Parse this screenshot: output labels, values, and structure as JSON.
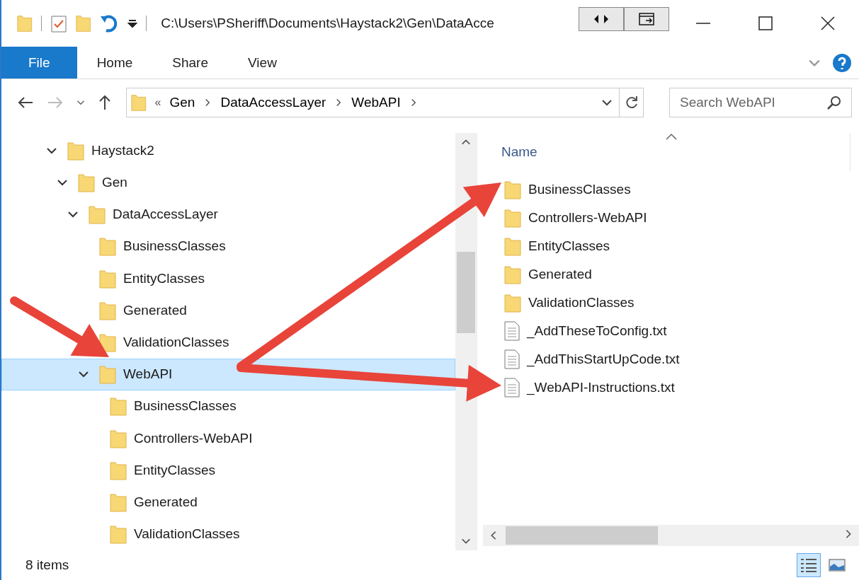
{
  "window": {
    "title": "C:\\Users\\PSheriff\\Documents\\Haystack2\\Gen\\DataAcce"
  },
  "ribbon": {
    "tabs": [
      {
        "label": "File",
        "selected": true
      },
      {
        "label": "Home",
        "selected": false
      },
      {
        "label": "Share",
        "selected": false
      },
      {
        "label": "View",
        "selected": false
      }
    ]
  },
  "address_bar": {
    "overflow": "«",
    "crumbs": [
      "Gen",
      "DataAccessLayer",
      "WebAPI"
    ]
  },
  "search": {
    "placeholder": "Search WebAPI"
  },
  "tree": [
    {
      "label": "Haystack2",
      "expanded": true,
      "selected": false,
      "children": [
        {
          "label": "Gen",
          "expanded": true,
          "selected": false,
          "children": [
            {
              "label": "DataAccessLayer",
              "expanded": true,
              "selected": false,
              "children": [
                {
                  "label": "BusinessClasses",
                  "expanded": false,
                  "selected": false
                },
                {
                  "label": "EntityClasses",
                  "expanded": false,
                  "selected": false
                },
                {
                  "label": "Generated",
                  "expanded": false,
                  "selected": false
                },
                {
                  "label": "ValidationClasses",
                  "expanded": false,
                  "selected": false
                },
                {
                  "label": "WebAPI",
                  "expanded": true,
                  "selected": true,
                  "children": [
                    {
                      "label": "BusinessClasses",
                      "expanded": false,
                      "selected": false
                    },
                    {
                      "label": "Controllers-WebAPI",
                      "expanded": false,
                      "selected": false
                    },
                    {
                      "label": "EntityClasses",
                      "expanded": false,
                      "selected": false
                    },
                    {
                      "label": "Generated",
                      "expanded": false,
                      "selected": false
                    },
                    {
                      "label": "ValidationClasses",
                      "expanded": false,
                      "selected": false
                    }
                  ]
                }
              ]
            }
          ]
        }
      ]
    }
  ],
  "file_list": {
    "columns": [
      "Name"
    ],
    "items": [
      {
        "name": "BusinessClasses",
        "kind": "folder"
      },
      {
        "name": "Controllers-WebAPI",
        "kind": "folder"
      },
      {
        "name": "EntityClasses",
        "kind": "folder"
      },
      {
        "name": "Generated",
        "kind": "folder"
      },
      {
        "name": "ValidationClasses",
        "kind": "folder"
      },
      {
        "name": "_AddTheseToConfig.txt",
        "kind": "file"
      },
      {
        "name": "_AddThisStartUpCode.txt",
        "kind": "file"
      },
      {
        "name": "_WebAPI-Instructions.txt",
        "kind": "file"
      }
    ]
  },
  "status_bar": {
    "count": "8 items"
  }
}
